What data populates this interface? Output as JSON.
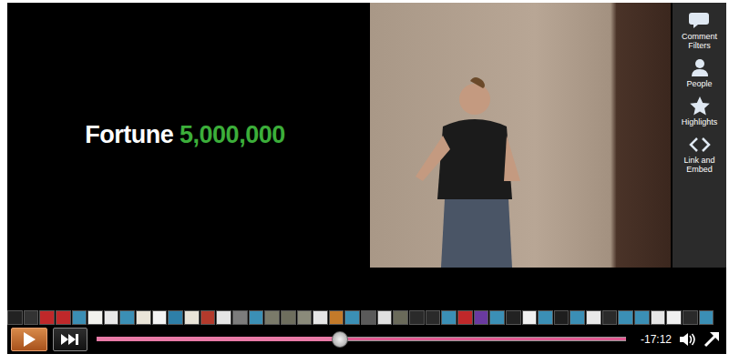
{
  "slide": {
    "parts": [
      {
        "text": "Fortune",
        "color": "#ffffff"
      },
      {
        "text": "5,000,000",
        "color": "#3cae3a"
      }
    ]
  },
  "sidebar": {
    "items": [
      {
        "label": "Comment Filters",
        "kind": "comment"
      },
      {
        "label": "People",
        "kind": "people"
      },
      {
        "label": "Highlights",
        "kind": "star"
      },
      {
        "label": "Link and Embed",
        "kind": "embed"
      }
    ]
  },
  "thumbnails": [
    {
      "color": "#222222"
    },
    {
      "color": "#333333"
    },
    {
      "color": "#c0282a"
    },
    {
      "color": "#c0282a"
    },
    {
      "color": "#3b8fb5"
    },
    {
      "color": "#f2f2ee"
    },
    {
      "color": "#e8e8e8"
    },
    {
      "color": "#3b8fb5"
    },
    {
      "color": "#e9e4d8"
    },
    {
      "color": "#f4f4f4"
    },
    {
      "color": "#2e7fa8"
    },
    {
      "color": "#e9e4d8"
    },
    {
      "color": "#b33a2c"
    },
    {
      "color": "#e5e5e5"
    },
    {
      "color": "#7c7c7c"
    },
    {
      "color": "#3b8fb5"
    },
    {
      "color": "#7a7a6a"
    },
    {
      "color": "#6e6e5e"
    },
    {
      "color": "#8a8a7a"
    },
    {
      "color": "#e6e6e6"
    },
    {
      "color": "#c37a2a"
    },
    {
      "color": "#3b8fb5"
    },
    {
      "color": "#5a5a5a"
    },
    {
      "color": "#e0e0e0"
    },
    {
      "color": "#6a6a5a"
    },
    {
      "color": "#2a2a2a"
    },
    {
      "color": "#2a2a2a"
    },
    {
      "color": "#3b8fb5"
    },
    {
      "color": "#c0282a"
    },
    {
      "color": "#6a3aa0"
    },
    {
      "color": "#3b8fb5"
    },
    {
      "color": "#222222"
    },
    {
      "color": "#f0f0f0"
    },
    {
      "color": "#3b8fb5"
    },
    {
      "color": "#1e1e1e"
    },
    {
      "color": "#3b8fb5"
    },
    {
      "color": "#e8e8e8"
    },
    {
      "color": "#2a2a2a"
    },
    {
      "color": "#3b8fb5"
    },
    {
      "color": "#3b8fb5"
    },
    {
      "color": "#e6e6e6"
    },
    {
      "color": "#f0f0f0"
    },
    {
      "color": "#2a2a2a"
    },
    {
      "color": "#3b8fb5"
    }
  ],
  "player": {
    "playing": false,
    "level": 0.46,
    "time": "-17:12"
  }
}
